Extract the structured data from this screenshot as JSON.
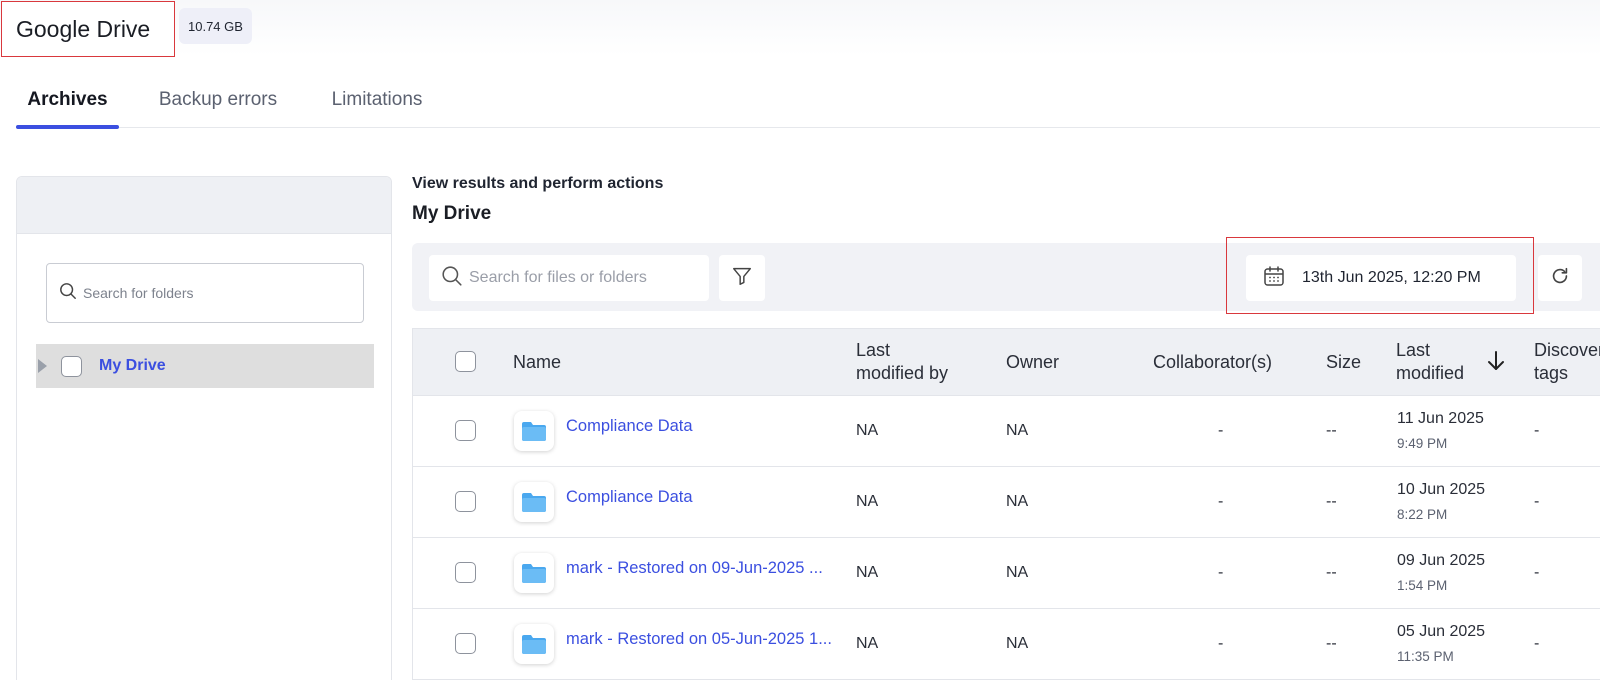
{
  "header": {
    "title": "Google Drive",
    "storage": "10.74 GB"
  },
  "tabs": [
    {
      "label": "Archives",
      "active": true
    },
    {
      "label": "Backup errors",
      "active": false
    },
    {
      "label": "Limitations",
      "active": false
    }
  ],
  "sidebar": {
    "search_placeholder": "Search for folders",
    "tree": [
      {
        "label": "My Drive",
        "selected": true
      }
    ]
  },
  "main": {
    "subtitle": "View results and perform actions",
    "title": "My Drive",
    "search_placeholder": "Search for files or folders",
    "date_filter": "13th Jun 2025, 12:20 PM"
  },
  "table": {
    "columns": {
      "name": "Name",
      "last_modified_by_1": "Last",
      "last_modified_by_2": "modified by",
      "owner": "Owner",
      "collaborators": "Collaborator(s)",
      "size": "Size",
      "last_modified_1": "Last",
      "last_modified_2": "modified",
      "discover_tags_1": "Discover",
      "discover_tags_2": "tags"
    },
    "rows": [
      {
        "name": "Compliance Data",
        "modified_by": "NA",
        "owner": "NA",
        "collaborators": "-",
        "size": "--",
        "date": "11 Jun 2025",
        "time": "9:49 PM",
        "tags": "-"
      },
      {
        "name": "Compliance Data",
        "modified_by": "NA",
        "owner": "NA",
        "collaborators": "-",
        "size": "--",
        "date": "10 Jun 2025",
        "time": "8:22 PM",
        "tags": "-"
      },
      {
        "name": "mark - Restored on 09-Jun-2025 ...",
        "modified_by": "NA",
        "owner": "NA",
        "collaborators": "-",
        "size": "--",
        "date": "09 Jun 2025",
        "time": "1:54 PM",
        "tags": "-"
      },
      {
        "name": "mark - Restored on 05-Jun-2025 1...",
        "modified_by": "NA",
        "owner": "NA",
        "collaborators": "-",
        "size": "--",
        "date": "05 Jun 2025",
        "time": "11:35 PM",
        "tags": "-"
      }
    ]
  },
  "colors": {
    "accent": "#3b4fe0",
    "highlight_border": "#d9383d",
    "folder": "#4aa8ef"
  },
  "icons": [
    "search-icon",
    "filter-icon",
    "calendar-icon",
    "refresh-icon",
    "folder-icon",
    "sort-arrow-down-icon",
    "caret-right-icon"
  ]
}
